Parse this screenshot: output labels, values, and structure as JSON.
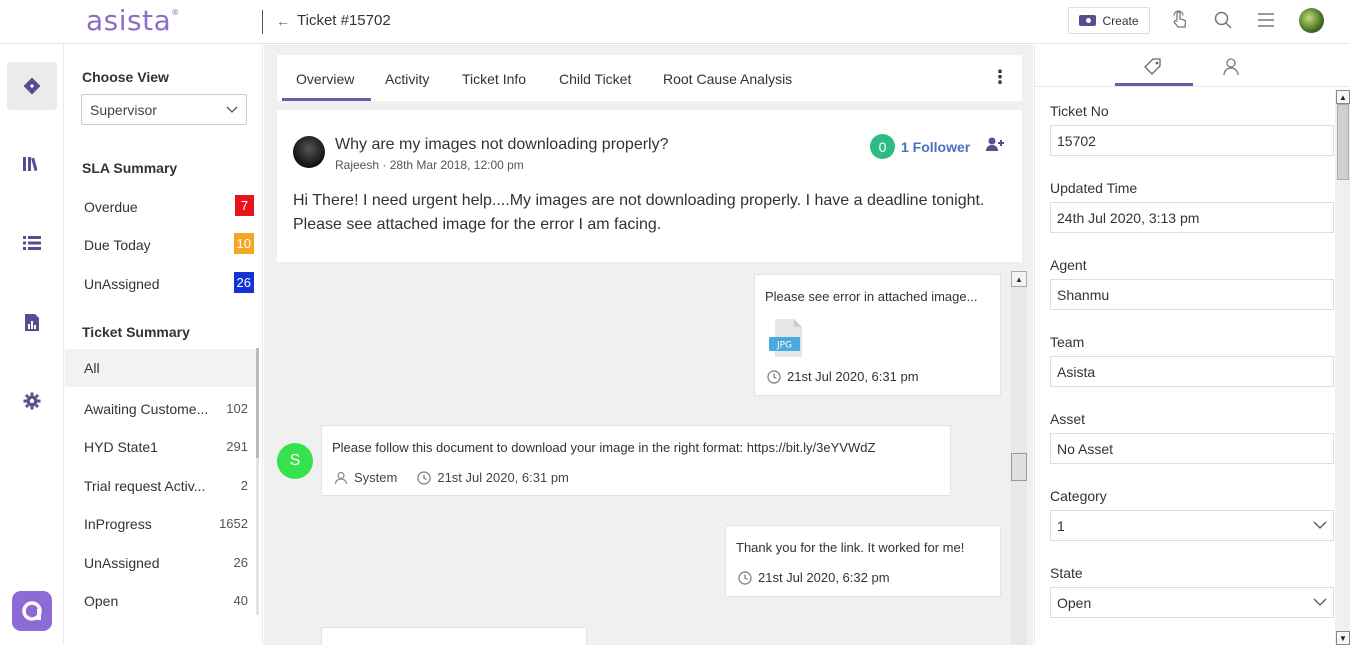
{
  "app": {
    "brand": "asista",
    "brand_mark": "®"
  },
  "header": {
    "back_icon": "arrow-left-icon",
    "ticket_title": "Ticket #15702",
    "create_label": "Create",
    "icons": [
      "touch-icon",
      "search-icon",
      "menu-icon",
      "user-avatar"
    ]
  },
  "rail": {
    "items": [
      "ticket-icon",
      "library-icon",
      "list-icon",
      "report-icon",
      "settings-icon"
    ],
    "brand_icon": "asista-app-icon"
  },
  "filter": {
    "choose_view_title": "Choose View",
    "view_value": "Supervisor",
    "sla_title": "SLA Summary",
    "sla": [
      {
        "label": "Overdue",
        "count": "7",
        "color": "#e8141a"
      },
      {
        "label": "Due Today",
        "count": "10",
        "color": "#f5a623"
      },
      {
        "label": "UnAssigned",
        "count": "26",
        "color": "#1432d6"
      }
    ],
    "ticket_summary_title": "Ticket Summary",
    "ticket_summary": [
      {
        "label": "All",
        "count": ""
      },
      {
        "label": "Awaiting Custome...",
        "count": "102"
      },
      {
        "label": "HYD State1",
        "count": "291"
      },
      {
        "label": "Trial request Activ...",
        "count": "2"
      },
      {
        "label": "InProgress",
        "count": "1652"
      },
      {
        "label": "UnAssigned",
        "count": "26"
      },
      {
        "label": "Open",
        "count": "40"
      }
    ]
  },
  "tabs": [
    "Overview",
    "Activity",
    "Ticket Info",
    "Child Ticket",
    "Root Cause Analysis"
  ],
  "post": {
    "subject": "Why are my images not downloading properly?",
    "author": "Rajeesh",
    "date": "28th Mar 2018, 12:00 pm",
    "meta_sep": "·",
    "followers_count": "0",
    "followers_label": "1 Follower",
    "body": "Hi There! I need urgent help....My images are not downloading properly. I have a deadline tonight. Please see attached image for the error I am facing."
  },
  "thread": [
    {
      "text": "Please see error in attached image...",
      "attachment": "JPG",
      "time": "21st Jul 2020, 6:31 pm"
    },
    {
      "avatar": "S",
      "text": "Please follow this document to download your image in the right format: https://bit.ly/3eYVWdZ",
      "by": "System",
      "time": "21st Jul 2020, 6:31 pm"
    },
    {
      "text": "Thank you for the link. It worked for me!",
      "time": "21st Jul 2020, 6:32 pm"
    }
  ],
  "right_panel": {
    "tab_icons": [
      "tag-icon",
      "user-icon"
    ],
    "fields": [
      {
        "label": "Ticket No",
        "value": "15702",
        "type": "text"
      },
      {
        "label": "Updated Time",
        "value": "24th Jul 2020, 3:13 pm",
        "type": "text"
      },
      {
        "label": "Agent",
        "value": "Shanmu",
        "type": "text"
      },
      {
        "label": "Team",
        "value": "Asista",
        "type": "text"
      },
      {
        "label": "Asset",
        "value": "No Asset",
        "type": "text"
      },
      {
        "label": "Category",
        "value": "1",
        "type": "select"
      },
      {
        "label": "State",
        "value": "Open",
        "type": "select"
      }
    ]
  },
  "colors": {
    "accent": "#6b5ba8",
    "brand": "#8b6fc2",
    "follower_badge": "#2dbd84",
    "system_avatar": "#36e24b"
  }
}
